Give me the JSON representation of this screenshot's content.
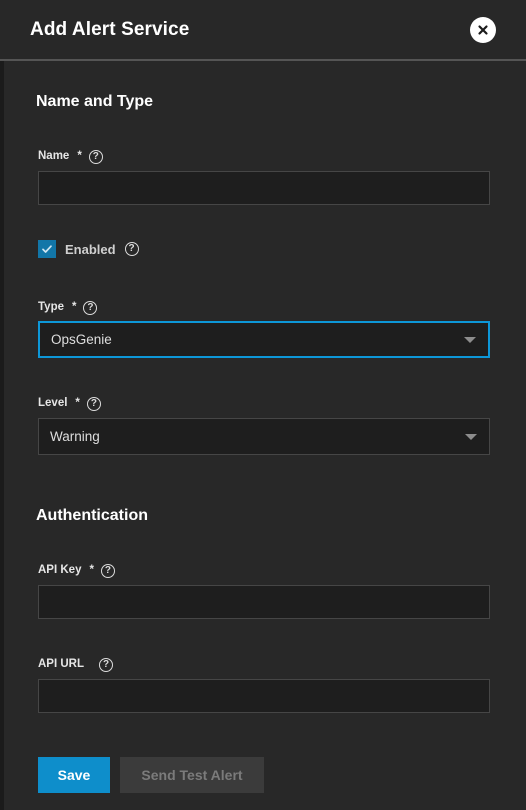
{
  "dialog": {
    "title": "Add Alert Service",
    "close_icon": "close-icon"
  },
  "sections": [
    {
      "title": "Name and Type"
    },
    {
      "title": "Authentication"
    }
  ],
  "fields": {
    "name": {
      "label": "Name",
      "required_marker": "*",
      "value": "",
      "placeholder": "",
      "help_icon": "help-icon"
    },
    "enabled": {
      "label": "Enabled",
      "checked": true,
      "check_icon": "checkmark-icon",
      "help_icon": "help-icon"
    },
    "type": {
      "label": "Type",
      "required_marker": "*",
      "value": "OpsGenie",
      "focused": true,
      "caret_icon": "chevron-down-icon",
      "help_icon": "help-icon"
    },
    "level": {
      "label": "Level",
      "required_marker": "*",
      "value": "Warning",
      "focused": false,
      "caret_icon": "chevron-down-icon",
      "help_icon": "help-icon"
    },
    "api_key": {
      "label": "API Key",
      "required_marker": "*",
      "value": "",
      "placeholder": "",
      "help_icon": "help-icon"
    },
    "api_url": {
      "label": "API URL",
      "required_marker": "",
      "value": "",
      "placeholder": "",
      "help_icon": "help-icon"
    }
  },
  "buttons": {
    "save": "Save",
    "send_test_alert": "Send Test Alert"
  },
  "colors": {
    "accent_blue": "#0e8ecb",
    "focus_blue": "#0d97d8",
    "checkbox_blue": "#1276a8",
    "background": "#282828",
    "input_background": "#1e1e1e",
    "input_border": "#464646",
    "disabled_button": "#3b3b3b",
    "disabled_text": "#7b7b7b"
  }
}
